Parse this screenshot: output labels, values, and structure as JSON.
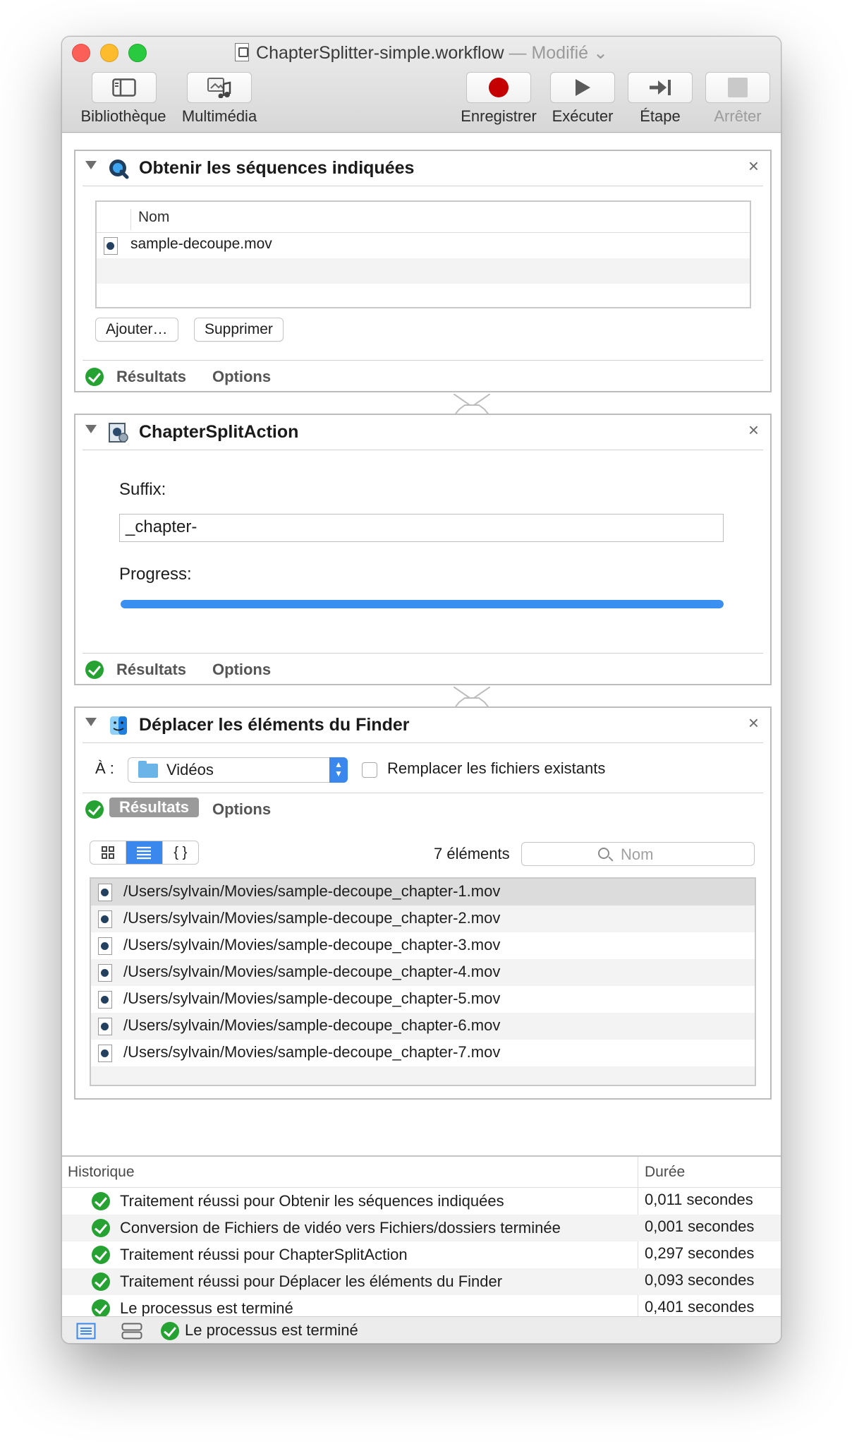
{
  "window": {
    "title": "ChapterSplitter-simple.workflow",
    "modified": "— Modifié"
  },
  "toolbar": {
    "library": "Bibliothèque",
    "media": "Multimédia",
    "record": "Enregistrer",
    "run": "Exécuter",
    "step": "Étape",
    "stop": "Arrêter"
  },
  "actions": {
    "get_items": {
      "title": "Obtenir les séquences indiquées",
      "column": "Nom",
      "files": [
        "sample-decoupe.mov"
      ],
      "add_button": "Ajouter…",
      "remove_button": "Supprimer",
      "results_tab": "Résultats",
      "options_tab": "Options"
    },
    "chapter_split": {
      "title": "ChapterSplitAction",
      "suffix_label": "Suffix:",
      "suffix_value": "_chapter-",
      "progress_label": "Progress:",
      "progress": 1.0,
      "results_tab": "Résultats",
      "options_tab": "Options"
    },
    "move_finder": {
      "title": "Déplacer les éléments du Finder",
      "to_label": "À :",
      "destination": "Vidéos",
      "replace_label": "Remplacer les fichiers existants",
      "replace_checked": false,
      "results_tab": "Résultats",
      "options_tab": "Options",
      "count": "7 éléments",
      "search_placeholder": "Nom",
      "results": [
        "/Users/sylvain/Movies/sample-decoupe_chapter-1.mov",
        "/Users/sylvain/Movies/sample-decoupe_chapter-2.mov",
        "/Users/sylvain/Movies/sample-decoupe_chapter-3.mov",
        "/Users/sylvain/Movies/sample-decoupe_chapter-4.mov",
        "/Users/sylvain/Movies/sample-decoupe_chapter-5.mov",
        "/Users/sylvain/Movies/sample-decoupe_chapter-6.mov",
        "/Users/sylvain/Movies/sample-decoupe_chapter-7.mov"
      ]
    }
  },
  "log": {
    "col_history": "Historique",
    "col_duration": "Durée",
    "entries": [
      {
        "message": "Traitement réussi pour Obtenir les séquences indiquées",
        "duration": "0,011 secondes"
      },
      {
        "message": "Conversion de Fichiers de vidéo vers Fichiers/dossiers terminée",
        "duration": "0,001 secondes"
      },
      {
        "message": "Traitement réussi pour ChapterSplitAction",
        "duration": "0,297 secondes"
      },
      {
        "message": "Traitement réussi pour Déplacer les éléments du Finder",
        "duration": "0,093 secondes"
      },
      {
        "message": "Le processus est terminé",
        "duration": "0,401 secondes"
      }
    ],
    "status": "Le processus est terminé"
  },
  "colors": {
    "accent": "#3a87ee",
    "success": "#25a232",
    "record": "#c40000"
  }
}
